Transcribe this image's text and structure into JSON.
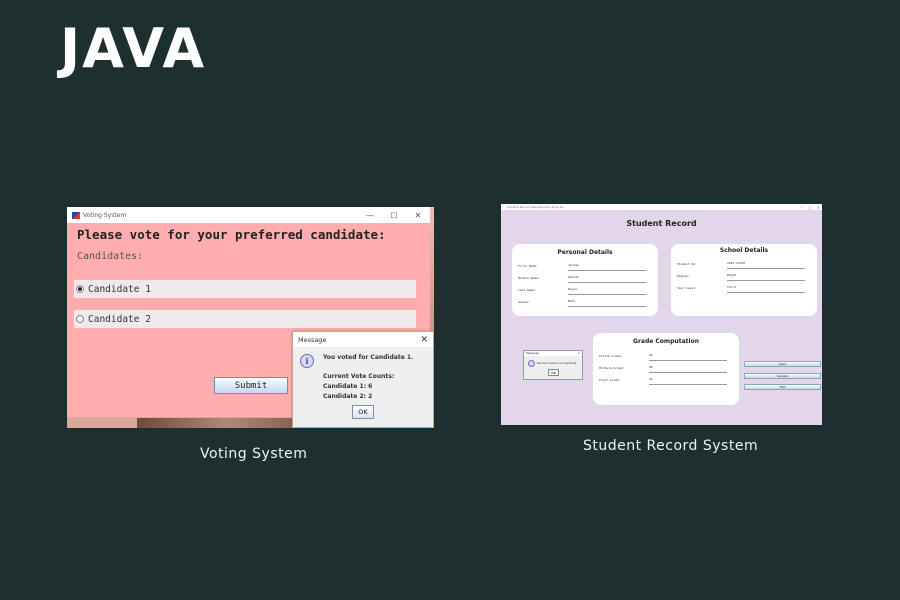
{
  "page": {
    "title": "JAVA",
    "captions": {
      "voting": "Voting System",
      "student_record": "Student Record System"
    }
  },
  "voting": {
    "window_title": "Voting System",
    "titlebar_buttons": {
      "minimize": "—",
      "maximize": "☐",
      "close": "✕"
    },
    "heading": "Please vote for your preferred candidate:",
    "candidates_label": "Candidates:",
    "candidates": [
      {
        "label": "Candidate 1",
        "selected": true
      },
      {
        "label": "Candidate 2",
        "selected": false
      }
    ],
    "submit_label": "Submit",
    "message": {
      "title": "Message",
      "close": "✕",
      "line1": "You voted for Candidate 1.",
      "line2": "Current Vote Counts:",
      "line3": "Candidate 1: 6",
      "line4": "Candidate 2: 2",
      "ok_label": "OK",
      "icon": "info-icon"
    },
    "colors": {
      "window_bg": "#ffadae"
    }
  },
  "student_record": {
    "window_title": "Student Record Management Program",
    "title": "Student Record",
    "personal": {
      "title": "Personal Details",
      "fields": [
        {
          "label": "First Name:",
          "value": "Jerome"
        },
        {
          "label": "Middle Name:",
          "value": "Palomo"
        },
        {
          "label": "Last Name:",
          "value": "Reyes"
        },
        {
          "label": "Gender:",
          "value": "Male"
        }
      ]
    },
    "school": {
      "title": "School Details",
      "fields": [
        {
          "label": "Student No:",
          "value": "2022-12345"
        },
        {
          "label": "Degree:",
          "value": "BSCpE"
        },
        {
          "label": "Year Level:",
          "value": "Third"
        }
      ]
    },
    "grades": {
      "title": "Grade Computation",
      "fields": [
        {
          "label": "Prelim Grade:",
          "value": "90"
        },
        {
          "label": "Midterm Grade:",
          "value": "90"
        },
        {
          "label": "Final Grade:",
          "value": "92"
        }
      ]
    },
    "buttons": [
      "Save",
      "Update",
      "Exit"
    ],
    "message": {
      "title": "Message",
      "text": "Record saved successfully.",
      "ok_label": "OK"
    },
    "colors": {
      "bg": "#e2d6eb"
    }
  }
}
